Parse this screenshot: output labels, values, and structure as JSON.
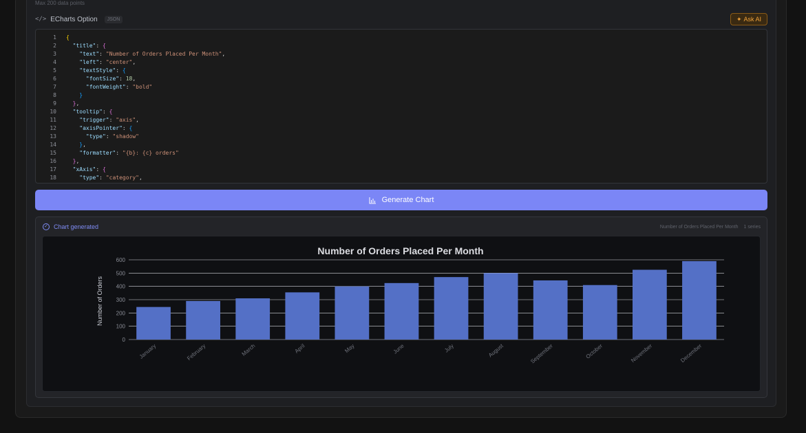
{
  "header": {
    "max_note": "Max 200 data points",
    "option_icon": "code-icon",
    "option_label": "ECharts Option",
    "format_badge": "JSON",
    "ask_ai_icon": "sparkles-icon",
    "ask_ai_label": "Ask AI"
  },
  "editor": {
    "line_numbers": [
      "1",
      "2",
      "3",
      "4",
      "5",
      "6",
      "7",
      "8",
      "9",
      "10",
      "11",
      "12",
      "13",
      "14",
      "15",
      "16",
      "17",
      "18"
    ]
  },
  "generate_button": {
    "icon": "bar-chart-icon",
    "label": "Generate Chart"
  },
  "result": {
    "status_icon": "check-circle-icon",
    "status_text": "Chart generated",
    "meta_title": "Number of Orders Placed Per Month",
    "meta_series": "1 series"
  },
  "colors": {
    "accent": "#7b86f6",
    "bar": "#5470c6",
    "ask_ai": "#f0a23a"
  },
  "chart_data": {
    "type": "bar",
    "title": "Number of Orders Placed Per Month",
    "ylabel": "Number of Orders",
    "xlabel": "",
    "categories": [
      "January",
      "February",
      "March",
      "April",
      "May",
      "June",
      "July",
      "August",
      "September",
      "October",
      "November",
      "December"
    ],
    "values": [
      245,
      290,
      310,
      355,
      400,
      425,
      470,
      500,
      445,
      410,
      525,
      590
    ],
    "ylim": [
      0,
      600
    ],
    "yticks": [
      0,
      100,
      200,
      300,
      400,
      500,
      600
    ],
    "grid": true
  }
}
